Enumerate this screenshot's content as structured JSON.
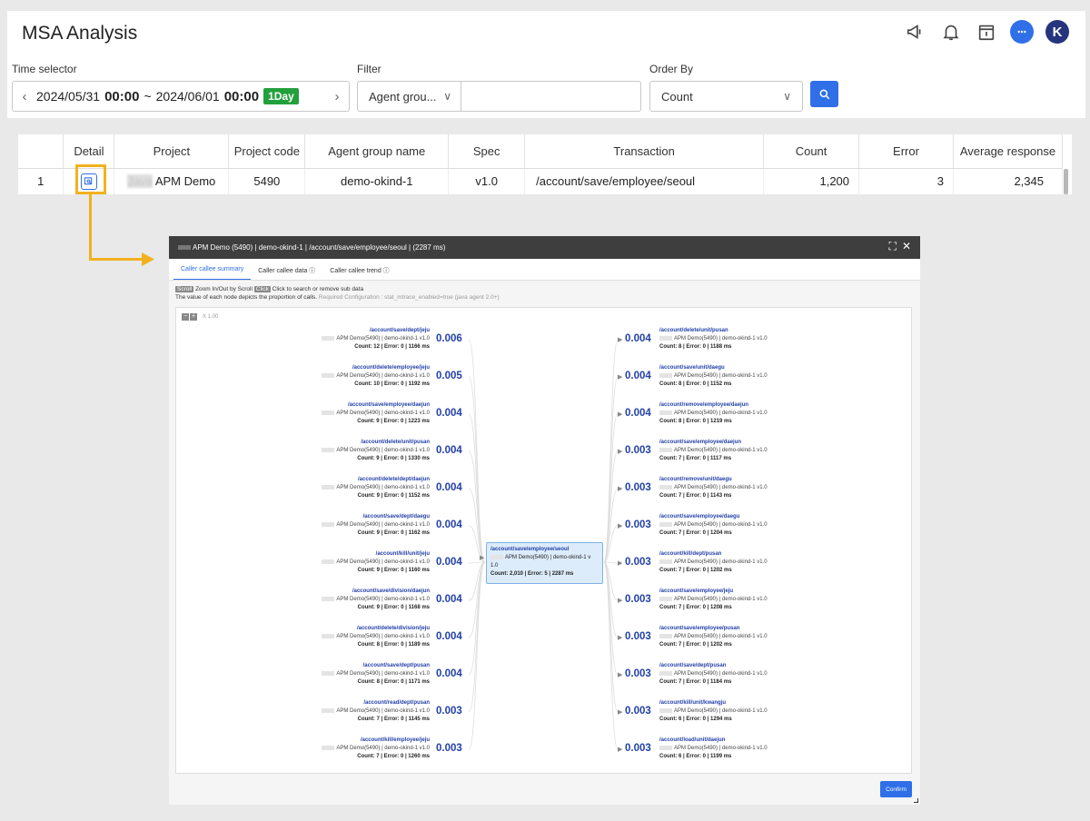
{
  "app": {
    "title": "MSA Analysis",
    "avatar_letter": "K"
  },
  "controls": {
    "time_label": "Time selector",
    "time_start_date": "2024/05/31",
    "time_start_time": "00:00",
    "time_sep": "~",
    "time_end_date": "2024/06/01",
    "time_end_time": "00:00",
    "time_badge": "1Day",
    "filter_label": "Filter",
    "filter_value": "Agent grou...",
    "order_label": "Order By",
    "order_value": "Count"
  },
  "table": {
    "headers": [
      "",
      "Detail",
      "Project",
      "Project code",
      "Agent group name",
      "Spec",
      "Transaction",
      "Count",
      "Error",
      "Average response"
    ],
    "row": {
      "index": "1",
      "project_blur": "Java",
      "project": "APM Demo",
      "project_code": "5490",
      "agent_group": "demo-okind-1",
      "spec": "v1.0",
      "transaction": "/account/save/employee/seoul",
      "count": "1,200",
      "error": "3",
      "avg_response": "2,345"
    }
  },
  "modal": {
    "title": "APM Demo (5490) | demo-okind-1 | /account/save/employee/seoul | (2287 ms)",
    "tabs": [
      "Caller callee summary",
      "Caller callee data",
      "Caller callee trend"
    ],
    "hint_scroll_key": "Scroll",
    "hint_scroll": "Zoom In/Out by Scroll",
    "hint_click_key": "Click",
    "hint_click": "Click to search or remove sub data",
    "hint_line2": "The value of each node depicts the proportion of calls.",
    "hint_config": "Required Configuration : stat_mtrace_enabled=true (java agent 2.0+)",
    "zoom": "X 1.00",
    "confirm": "Confirm",
    "center": {
      "title": "/account/save/employee/seoul",
      "sub": "APM Demo(5490) | demo-okind-1 v 1.0",
      "count": "Count: 2,010 | Error: 5 | 2287 ms"
    },
    "callers": [
      {
        "title": "/account/save/dept/jeju",
        "sub": "APM Demo(5490) | demo-okind-1 v1.0",
        "count": "Count: 12 | Error: 0 | 1166 ms",
        "value": "0.006"
      },
      {
        "title": "/account/delete/employee/jeju",
        "sub": "APM Demo(5490) | demo-okind-1 v1.0",
        "count": "Count: 10 | Error: 0 | 1192 ms",
        "value": "0.005"
      },
      {
        "title": "/account/save/employee/daejun",
        "sub": "APM Demo(5490) | demo-okind-1 v1.0",
        "count": "Count: 9 | Error: 0 | 1223 ms",
        "value": "0.004"
      },
      {
        "title": "/account/delete/unit/pusan",
        "sub": "APM Demo(5490) | demo-okind-1 v1.0",
        "count": "Count: 9 | Error: 0 | 1330 ms",
        "value": "0.004"
      },
      {
        "title": "/account/delete/dept/daejun",
        "sub": "APM Demo(5490) | demo-okind-1 v1.0",
        "count": "Count: 9 | Error: 0 | 1152 ms",
        "value": "0.004"
      },
      {
        "title": "/account/save/dept/daegu",
        "sub": "APM Demo(5490) | demo-okind-1 v1.0",
        "count": "Count: 9 | Error: 0 | 1162 ms",
        "value": "0.004"
      },
      {
        "title": "/account/kill/unit/jeju",
        "sub": "APM Demo(5490) | demo-okind-1 v1.0",
        "count": "Count: 9 | Error: 0 | 1160 ms",
        "value": "0.004"
      },
      {
        "title": "/account/save/division/daejun",
        "sub": "APM Demo(5490) | demo-okind-1 v1.0",
        "count": "Count: 9 | Error: 0 | 1168 ms",
        "value": "0.004"
      },
      {
        "title": "/account/delete/division/jeju",
        "sub": "APM Demo(5490) | demo-okind-1 v1.0",
        "count": "Count: 8 | Error: 0 | 1189 ms",
        "value": "0.004"
      },
      {
        "title": "/account/save/dept/pusan",
        "sub": "APM Demo(5490) | demo-okind-1 v1.0",
        "count": "Count: 8 | Error: 0 | 1171 ms",
        "value": "0.004"
      },
      {
        "title": "/account/read/dept/pusan",
        "sub": "APM Demo(5490) | demo-okind-1 v1.0",
        "count": "Count: 7 | Error: 0 | 1145 ms",
        "value": "0.003"
      },
      {
        "title": "/account/kill/employee/jeju",
        "sub": "APM Demo(5490) | demo-okind-1 v1.0",
        "count": "Count: 7 | Error: 0 | 1260 ms",
        "value": "0.003"
      }
    ],
    "callees": [
      {
        "title": "/account/delete/unit/pusan",
        "sub": "APM Demo(5490) | demo-okind-1 v1.0",
        "count": "Count: 8 | Error: 0 | 1188 ms",
        "value": "0.004"
      },
      {
        "title": "/account/save/unit/daegu",
        "sub": "APM Demo(5490) | demo-okind-1 v1.0",
        "count": "Count: 8 | Error: 0 | 1152 ms",
        "value": "0.004"
      },
      {
        "title": "/account/remove/employee/daejun",
        "sub": "APM Demo(5490) | demo-okind-1 v1.0",
        "count": "Count: 8 | Error: 0 | 1219 ms",
        "value": "0.004"
      },
      {
        "title": "/account/save/employee/daejun",
        "sub": "APM Demo(5490) | demo-okind-1 v1.0",
        "count": "Count: 7 | Error: 0 | 1117 ms",
        "value": "0.003"
      },
      {
        "title": "/account/remove/unit/daegu",
        "sub": "APM Demo(5490) | demo-okind-1 v1.0",
        "count": "Count: 7 | Error: 0 | 1143 ms",
        "value": "0.003"
      },
      {
        "title": "/account/save/employee/daegu",
        "sub": "APM Demo(5490) | demo-okind-1 v1.0",
        "count": "Count: 7 | Error: 0 | 1204 ms",
        "value": "0.003"
      },
      {
        "title": "/account/kill/dept/pusan",
        "sub": "APM Demo(5490) | demo-okind-1 v1.0",
        "count": "Count: 7 | Error: 0 | 1202 ms",
        "value": "0.003"
      },
      {
        "title": "/account/save/employee/jeju",
        "sub": "APM Demo(5490) | demo-okind-1 v1.0",
        "count": "Count: 7 | Error: 0 | 1208 ms",
        "value": "0.003"
      },
      {
        "title": "/account/save/employee/pusan",
        "sub": "APM Demo(5490) | demo-okind-1 v1.0",
        "count": "Count: 7 | Error: 0 | 1202 ms",
        "value": "0.003"
      },
      {
        "title": "/account/save/dept/pusan",
        "sub": "APM Demo(5490) | demo-okind-1 v1.0",
        "count": "Count: 7 | Error: 0 | 1184 ms",
        "value": "0.003"
      },
      {
        "title": "/account/kill/unit/kwangju",
        "sub": "APM Demo(5490) | demo-okind-1 v1.0",
        "count": "Count: 6 | Error: 0 | 1294 ms",
        "value": "0.003"
      },
      {
        "title": "/account/load/unit/daejun",
        "sub": "APM Demo(5490) | demo-okind-1 v1.0",
        "count": "Count: 6 | Error: 0 | 1199 ms",
        "value": "0.003"
      }
    ]
  }
}
